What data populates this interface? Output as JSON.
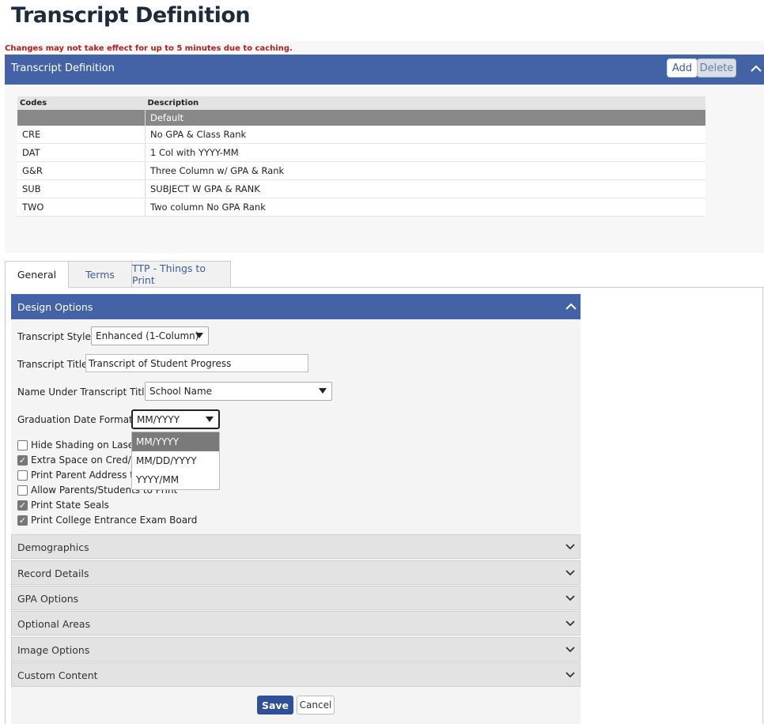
{
  "page": {
    "title": "Transcript Definition",
    "cache_note": "Changes may not take effect for up to 5 minutes due to caching."
  },
  "header_bar": {
    "title": "Transcript Definition",
    "add_label": "Add",
    "delete_label": "Delete"
  },
  "codes_table": {
    "columns": [
      "Codes",
      "Description"
    ],
    "rows": [
      {
        "code": "",
        "description": "Default",
        "selected": true
      },
      {
        "code": "CRE",
        "description": "No GPA & Class Rank"
      },
      {
        "code": "DAT",
        "description": "1 Col with YYYY-MM"
      },
      {
        "code": "G&R",
        "description": "Three Column w/ GPA & Rank"
      },
      {
        "code": "SUB",
        "description": "SUBJECT W GPA & RANK"
      },
      {
        "code": "TWO",
        "description": "Two column No GPA Rank"
      }
    ]
  },
  "tabs": [
    {
      "label": "General",
      "active": true
    },
    {
      "label": "Terms"
    },
    {
      "label": "TTP - Things to Print"
    }
  ],
  "design_options": {
    "title": "Design Options",
    "transcript_style_label": "Transcript Style:",
    "transcript_style_value": "Enhanced (1-Column)",
    "transcript_title_label": "Transcript Title:",
    "transcript_title_value": "Transcript of Student Progress",
    "name_under_label": "Name Under Transcript Title:",
    "name_under_value": "School Name",
    "grad_date_label": "Graduation Date Format:",
    "grad_date_value": "MM/YYYY",
    "grad_date_options": [
      "MM/YYYY",
      "MM/DD/YYYY",
      "YYYY/MM"
    ],
    "checkboxes": [
      {
        "label": "Hide Shading on Laser",
        "checked": false
      },
      {
        "label": "Extra Space on Cred/G",
        "checked": true
      },
      {
        "label": "Print Parent Address to",
        "checked": false
      },
      {
        "label": "Allow Parents/Students to Print",
        "checked": false
      },
      {
        "label": "Print State Seals",
        "checked": true
      },
      {
        "label": "Print College Entrance Exam Board",
        "checked": true
      }
    ]
  },
  "sections": [
    "Demographics",
    "Record Details",
    "GPA Options",
    "Optional Areas",
    "Image Options",
    "Custom Content"
  ],
  "footer": {
    "save_label": "Save",
    "cancel_label": "Cancel"
  },
  "colors": {
    "header_blue": "#4363a6",
    "save_blue": "#2f4f99",
    "warning_red": "#b0201e"
  }
}
